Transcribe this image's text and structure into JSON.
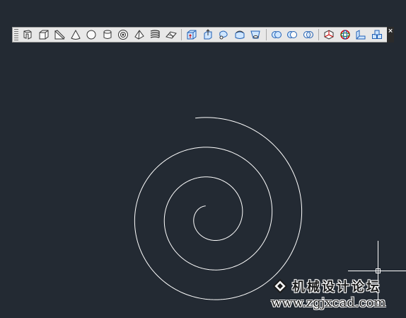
{
  "app": {
    "canvas_background": "#232a33",
    "toolbar_background": "#e8e8e8",
    "drawing_color": "#ffffff"
  },
  "toolbar": {
    "close_label": "×",
    "groups": [
      {
        "name": "primitives",
        "icons": [
          "polysolid-icon",
          "box-icon",
          "wedge-icon",
          "cone-icon",
          "sphere-icon",
          "cylinder-icon",
          "torus-icon",
          "pyramid-icon",
          "helix-icon",
          "planar-surface-icon"
        ]
      },
      {
        "name": "solid-creation",
        "icons": [
          "extrude-icon",
          "presspull-icon",
          "sweep-icon",
          "revolve-icon",
          "loft-icon"
        ]
      },
      {
        "name": "boolean",
        "icons": [
          "union-icon",
          "subtract-icon",
          "intersect-icon"
        ]
      },
      {
        "name": "modify",
        "icons": [
          "3d-move-icon",
          "3d-rotate-icon",
          "3d-align-icon",
          "3d-array-icon"
        ]
      }
    ]
  },
  "drawing": {
    "object": "spiral-helix",
    "turns": 3
  },
  "watermark": {
    "title": "机械设计论坛",
    "url": "www.zgjxcad.com"
  }
}
